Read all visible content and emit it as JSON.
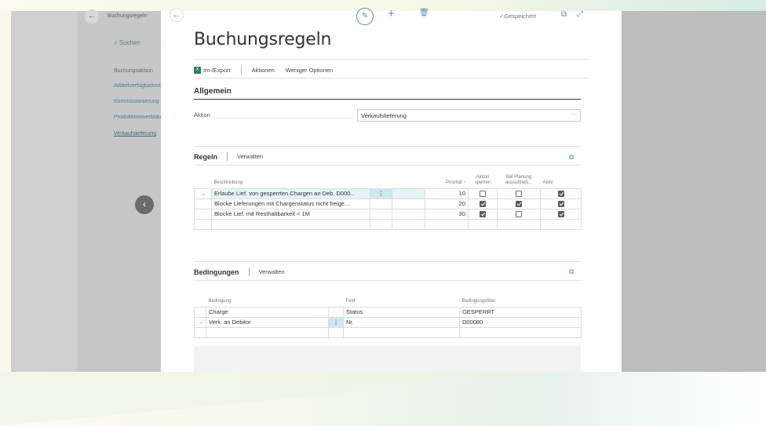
{
  "background_app": {
    "title": "Buchungsregeln",
    "search_label": "Suchen",
    "nav_items": [
      {
        "label": "Buchungsaktion",
        "style": "plain"
      },
      {
        "label": "Artikelverfügbarkeit",
        "style": "link"
      },
      {
        "label": "Kommissionierung",
        "style": "link"
      },
      {
        "label": "Produktionsverbrauch",
        "style": "link"
      },
      {
        "label": "Verkaufslieferung",
        "style": "active"
      }
    ]
  },
  "toolbar": {
    "saved_label": "Gespeichert"
  },
  "page": {
    "title": "Buchungsregeln"
  },
  "action_bar": {
    "import_export": "Im-/Export",
    "actions": "Aktionen",
    "fewer_options": "Weniger Optionen"
  },
  "general": {
    "title": "Allgemein",
    "action_label": "Aktion",
    "action_value": "Verkaufslieferung"
  },
  "rules": {
    "title": "Regeln",
    "manage": "Verwalten",
    "columns": {
      "description": "Beschreibung",
      "priority": "Priorität ↑",
      "block_action_1": "Aktion",
      "block_action_2": "sperren",
      "exclude_planning_1": "Bei Planung",
      "exclude_planning_2": "ausschließ...",
      "active": "Aktiv"
    },
    "rows": [
      {
        "current": true,
        "description": "Erlaube Lief. von gesperrten Chargen an Deb. D000...",
        "priority": "10",
        "block": false,
        "exclude": false,
        "active": true
      },
      {
        "current": false,
        "description": "Blocke Lieferungen mit Chargenstatus nicht freige...",
        "priority": "20",
        "block": true,
        "exclude": true,
        "active": true
      },
      {
        "current": false,
        "description": "Blocke Lief. mit Resthaltbarkeit < 1M",
        "priority": "30",
        "block": true,
        "exclude": false,
        "active": true
      }
    ]
  },
  "conditions": {
    "title": "Bedingungen",
    "manage": "Verwalten",
    "columns": {
      "condition": "Bedingung",
      "field": "Feld",
      "filter": "Bedingungsfilter"
    },
    "rows": [
      {
        "current": false,
        "condition": "Charge",
        "field": "Status",
        "filter": "GESPERRT"
      },
      {
        "current": true,
        "condition": "Verk. an Debitor",
        "field": "Nr.",
        "filter": "D00080"
      }
    ]
  }
}
